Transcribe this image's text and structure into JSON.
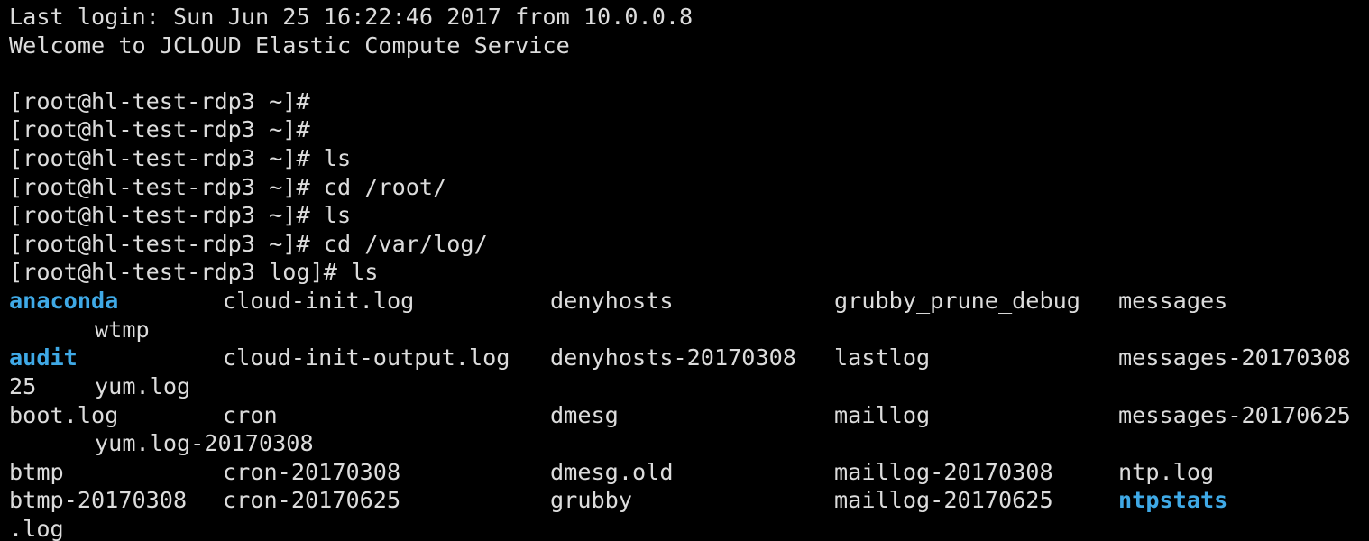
{
  "colors": {
    "background": "#000000",
    "text": "#dcdcdc",
    "directory": "#3fa9e6"
  },
  "header": {
    "last_login": "Last login: Sun Jun 25 16:22:46 2017 from 10.0.0.8",
    "welcome": "Welcome to JCLOUD Elastic Compute Service"
  },
  "session": {
    "prompts": [
      "[root@hl-test-rdp3 ~]#",
      "[root@hl-test-rdp3 ~]#",
      "[root@hl-test-rdp3 ~]# ls",
      "[root@hl-test-rdp3 ~]# cd /root/",
      "[root@hl-test-rdp3 ~]# ls",
      "[root@hl-test-rdp3 ~]# cd /var/log/",
      "[root@hl-test-rdp3 log]# ls"
    ]
  },
  "listing": {
    "row1": [
      "anaconda",
      "cloud-init.log",
      "denyhosts",
      "grubby_prune_debug",
      "messages"
    ],
    "row1_wrap": "wtmp",
    "row2": [
      "audit",
      "cloud-init-output.log",
      "denyhosts-20170308",
      "lastlog",
      "messages-20170308"
    ],
    "row2_wrap": [
      "25",
      "yum.log"
    ],
    "row3": [
      "boot.log",
      "cron",
      "dmesg",
      "maillog",
      "messages-20170625"
    ],
    "row3_wrap": "yum.log-20170308",
    "row4": [
      "btmp",
      "cron-20170308",
      "dmesg.old",
      "maillog-20170308",
      "ntp.log"
    ],
    "row5": [
      "btmp-20170308",
      "cron-20170625",
      "grubby",
      "maillog-20170625",
      "ntpstats"
    ],
    "row5_wrap": ".log"
  }
}
